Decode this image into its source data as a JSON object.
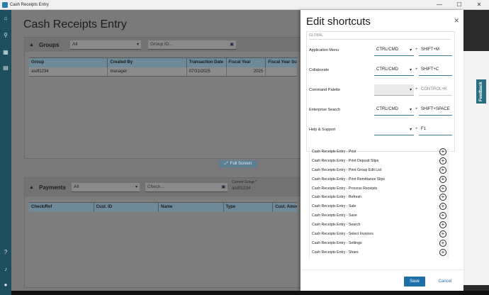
{
  "window": {
    "title": "Cash Receipts Entry",
    "minimize": "—",
    "maximize": "☐",
    "close": "✕"
  },
  "rail": {
    "icons": [
      "home-icon",
      "search-icon",
      "apps-icon",
      "dashboard-icon",
      "help-icon",
      "bell-icon",
      "user-icon"
    ]
  },
  "page": {
    "title": "Cash Receipts Entry",
    "full_screen": "Full Screen"
  },
  "groups": {
    "title": "Groups",
    "filter": "All",
    "search_placeholder": "Group ID...",
    "columns": [
      "Group",
      "Created By",
      "Transaction Date",
      "Fiscal Year",
      "Fiscal Year Suff"
    ],
    "rows": [
      {
        "group": "asdf1234",
        "created_by": "manager",
        "transaction_date": "07/31/2025",
        "fiscal_year": "2025",
        "suffix": ""
      }
    ]
  },
  "payments": {
    "title": "Payments",
    "filter": "All",
    "search_placeholder": "Check...",
    "current_group_label": "Current Group *",
    "current_group_value": "asdf1234",
    "columns": [
      "Check/Ref",
      "Cust. ID",
      "Name",
      "Type",
      "Cust. Amou"
    ]
  },
  "drawer": {
    "title": "Edit shortcuts",
    "section_label": "GLOBAL",
    "shortcuts": [
      {
        "name": "Application Menu",
        "modifier": "CTRL/CMD",
        "key": "SHIFT+M"
      },
      {
        "name": "Collaborate",
        "modifier": "CTRL/CMD",
        "key": "SHIFT+C"
      },
      {
        "name": "Command Palette",
        "modifier": "",
        "key": "CONTROL+K"
      },
      {
        "name": "Enterprise Search",
        "modifier": "CTRL/CMD",
        "key": "SHIFT+SPACE"
      },
      {
        "name": "Help & Support",
        "modifier": "",
        "key": "F1"
      }
    ],
    "commands": [
      "Cash Receipts Entry - Post",
      "Cash Receipts Entry - Print Deposit Slips",
      "Cash Receipts Entry - Print Group Edit List",
      "Cash Receipts Entry - Print Remittance Slips",
      "Cash Receipts Entry - Process Receipts",
      "Cash Receipts Entry - Refresh",
      "Cash Receipts Entry - Sale",
      "Cash Receipts Entry - Save",
      "Cash Receipts Entry - Search",
      "Cash Receipts Entry - Select Invoices",
      "Cash Receipts Entry - Settings",
      "Cash Receipts Entry - Share"
    ],
    "save": "Save",
    "cancel": "Cancel"
  },
  "feedback": "Feedback"
}
